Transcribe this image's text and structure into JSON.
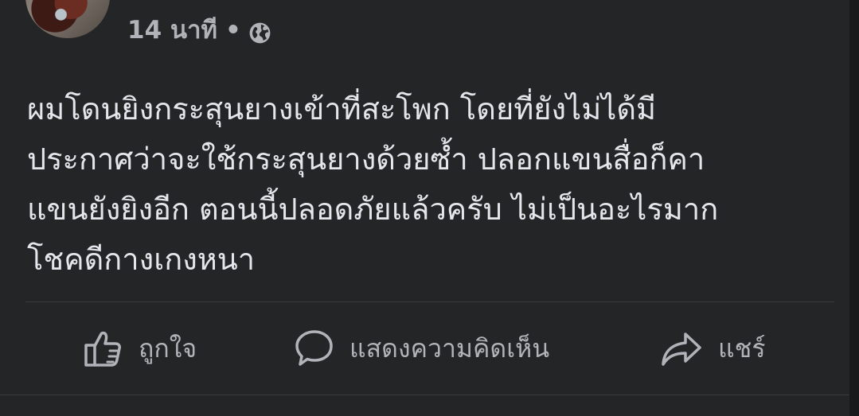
{
  "post": {
    "timestamp": "14 นาที",
    "separator": "•",
    "privacy_icon": "globe-icon",
    "text": "ผมโดนยิงกระสุนยางเข้าที่สะโพก โดยที่ยังไม่ได้มี\nประกาศว่าจะใช้กระสุนยางด้วยซ้ำ ปลอกแขนสื่อก็คา\nแขนยังยิงอีก ตอนนี้ปลอดภัยแล้วครับ ไม่เป็นอะไรมาก\nโชคดีกางเกงหนา"
  },
  "actions": {
    "like": {
      "label": "ถูกใจ",
      "icon": "thumbs-up-icon"
    },
    "comment": {
      "label": "แสดงความคิดเห็น",
      "icon": "comment-icon"
    },
    "share": {
      "label": "แชร์",
      "icon": "share-icon"
    }
  },
  "theme": {
    "background": "#242526",
    "text": "#e4e6eb",
    "secondary_text": "#b0b3b8",
    "divider": "#3a3b3c"
  }
}
